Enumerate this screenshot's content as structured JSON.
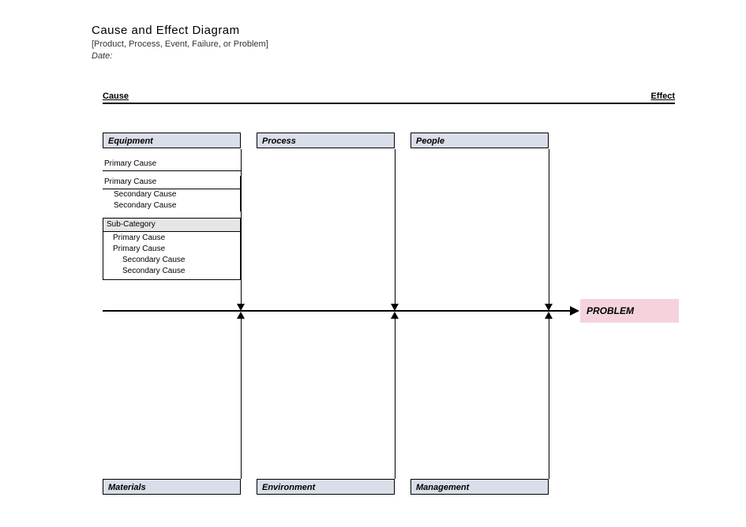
{
  "header": {
    "title": "Cause and Effect Diagram",
    "subtitle": "[Product, Process, Event, Failure, or Problem]",
    "date_label": "Date:"
  },
  "axis": {
    "cause_label": "Cause",
    "effect_label": "Effect"
  },
  "categories": {
    "top": [
      {
        "label": "Equipment"
      },
      {
        "label": "Process"
      },
      {
        "label": "People"
      }
    ],
    "bottom": [
      {
        "label": "Materials"
      },
      {
        "label": "Environment"
      },
      {
        "label": "Management"
      }
    ]
  },
  "equipment_causes": {
    "primary1": "Primary Cause",
    "group": {
      "primary": "Primary Cause",
      "secondary1": "Secondary Cause",
      "secondary2": "Secondary Cause"
    },
    "subcategory": {
      "header": "Sub-Category",
      "primary1": "Primary Cause",
      "primary2": "Primary Cause",
      "secondary1": "Secondary Cause",
      "secondary2": "Secondary Cause"
    }
  },
  "problem": {
    "label": "PROBLEM"
  }
}
